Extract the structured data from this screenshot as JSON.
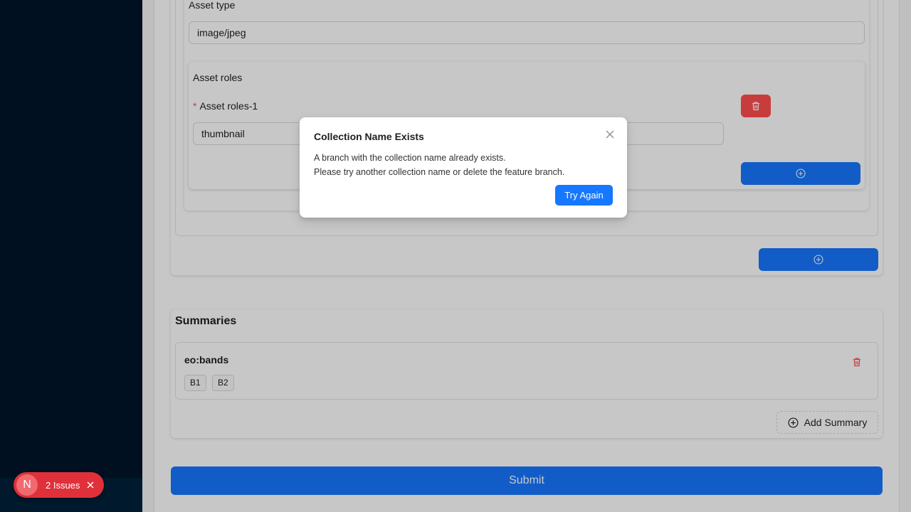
{
  "asset": {
    "type_label": "Asset type",
    "type_value": "image/jpeg",
    "roles_label": "Asset roles",
    "role_item_label": "Asset roles-1",
    "role_item_value": "thumbnail"
  },
  "summaries": {
    "title": "Summaries",
    "items": [
      {
        "key": "eo:bands",
        "tags": [
          "B1",
          "B2"
        ]
      }
    ],
    "add_label": "Add Summary"
  },
  "submit_label": "Submit",
  "modal": {
    "title": "Collection Name Exists",
    "line1": "A branch with the collection name already exists.",
    "line2": "Please try another collection name or delete the feature branch.",
    "ok_label": "Try Again"
  },
  "dev_badge": {
    "logo": "N",
    "text": "2 Issues"
  },
  "colors": {
    "primary": "#1677ff",
    "danger": "#ff4d4f",
    "sidebar": "#001529",
    "badge": "#e0313a"
  },
  "icons": [
    "trash-icon",
    "plus-circle-icon",
    "close-icon"
  ]
}
